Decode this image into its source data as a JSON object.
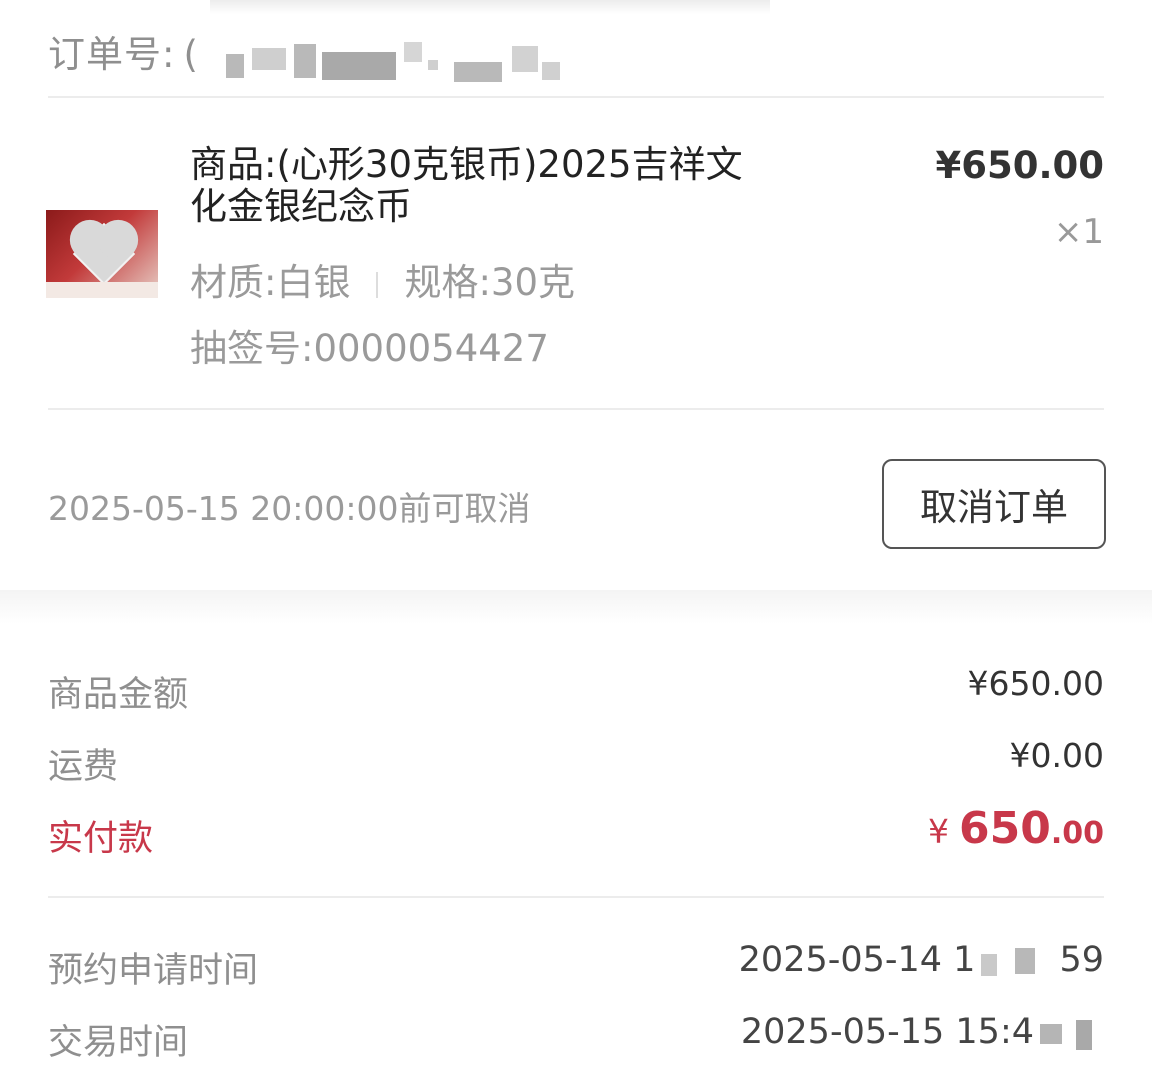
{
  "order": {
    "label": "订单号:",
    "number_visible": "("
  },
  "product": {
    "name": "商品:(心形30克银币)2025吉祥文化金银纪念币",
    "price": "¥650.00",
    "quantity": "×1",
    "material": "材质:白银",
    "spec": "规格:30克",
    "lottery": "抽签号:0000054427"
  },
  "cancel": {
    "hint": "2025-05-15 20:00:00前可取消",
    "button_label": "取消订单"
  },
  "summary": {
    "goods_amount_label": "商品金额",
    "goods_amount_value": "¥650.00",
    "shipping_label": "运费",
    "shipping_value": "¥0.00",
    "paid_label": "实付款",
    "paid_currency": "¥",
    "paid_integer": "650",
    "paid_decimal": ".00"
  },
  "times": {
    "reserve_label": "预约申请时间",
    "reserve_value": "2025-05-14 1",
    "reserve_tail": "59",
    "trade_label": "交易时间",
    "trade_value": "2025-05-15 15:4"
  },
  "colors": {
    "accent_red": "#c8384a",
    "muted_text": "#9a9a9a",
    "divider": "#ececec"
  }
}
